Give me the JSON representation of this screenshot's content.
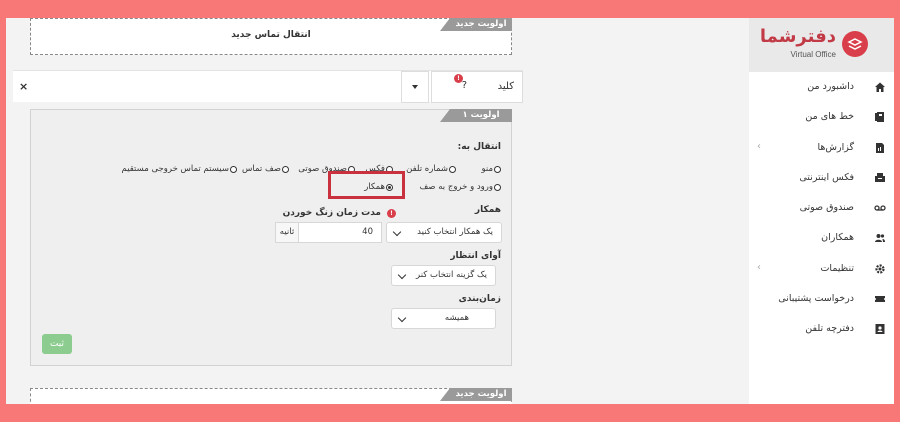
{
  "sidebar": {
    "logo_text": "دفترشما",
    "logo_sub": "Virtual Office",
    "items": [
      {
        "label": "داشبورد من",
        "icon": "home-icon",
        "has_children": false
      },
      {
        "label": "خط های من",
        "icon": "phone-lines-icon",
        "has_children": false
      },
      {
        "label": "گزارش‌ها",
        "icon": "report-icon",
        "has_children": true
      },
      {
        "label": "فکس اینترنتی",
        "icon": "fax-icon",
        "has_children": false
      },
      {
        "label": "صندوق صوتی",
        "icon": "voicemail-icon",
        "has_children": false
      },
      {
        "label": "همکاران",
        "icon": "users-icon",
        "has_children": false
      },
      {
        "label": "تنظیمات",
        "icon": "gear-icon",
        "has_children": true
      },
      {
        "label": "درخواست پشتیبانی",
        "icon": "ticket-icon",
        "has_children": false
      },
      {
        "label": "دفترچه تلفن",
        "icon": "contact-book-icon",
        "has_children": false
      }
    ]
  },
  "top_panel": {
    "ribbon": "اولویت جدید",
    "title": "انتقال تماس جدید"
  },
  "key_row": {
    "label": "کلید",
    "question": "?",
    "badge": "!",
    "close": "×"
  },
  "form": {
    "ribbon": "اولویت ۱",
    "transfer_label": "انتقال به:",
    "radios": [
      {
        "label": "منو",
        "checked": false
      },
      {
        "label": "شماره تلفن",
        "checked": false
      },
      {
        "label": "فکس",
        "checked": false
      },
      {
        "label": "صندوق صوتی",
        "checked": false
      },
      {
        "label": "صف تماس",
        "checked": false
      },
      {
        "label": "سیستم تماس خروجی مستقیم",
        "checked": false
      },
      {
        "label": "ورود و خروج به صف",
        "checked": false
      },
      {
        "label": "همکار",
        "checked": true
      }
    ],
    "colleague_label": "همکار",
    "colleague_select": "یک همکار انتخاب کنید",
    "ring_label": "مدت زمان زنگ خوردن",
    "ring_badge": "!",
    "ring_value": "40",
    "ring_unit": "ثانیه",
    "hold_label": "آوای انتظار",
    "hold_select": "یک گزینه انتخاب کنر",
    "schedule_label": "زمان‌بندی",
    "schedule_select": "همیشه",
    "submit": "ثبت"
  },
  "bottom_panel": {
    "ribbon": "اولویت جدید"
  },
  "colors": {
    "frame": "#f87777",
    "accent": "#d93f4a",
    "highlight": "#c8313d",
    "submit": "#8ccc8f"
  }
}
